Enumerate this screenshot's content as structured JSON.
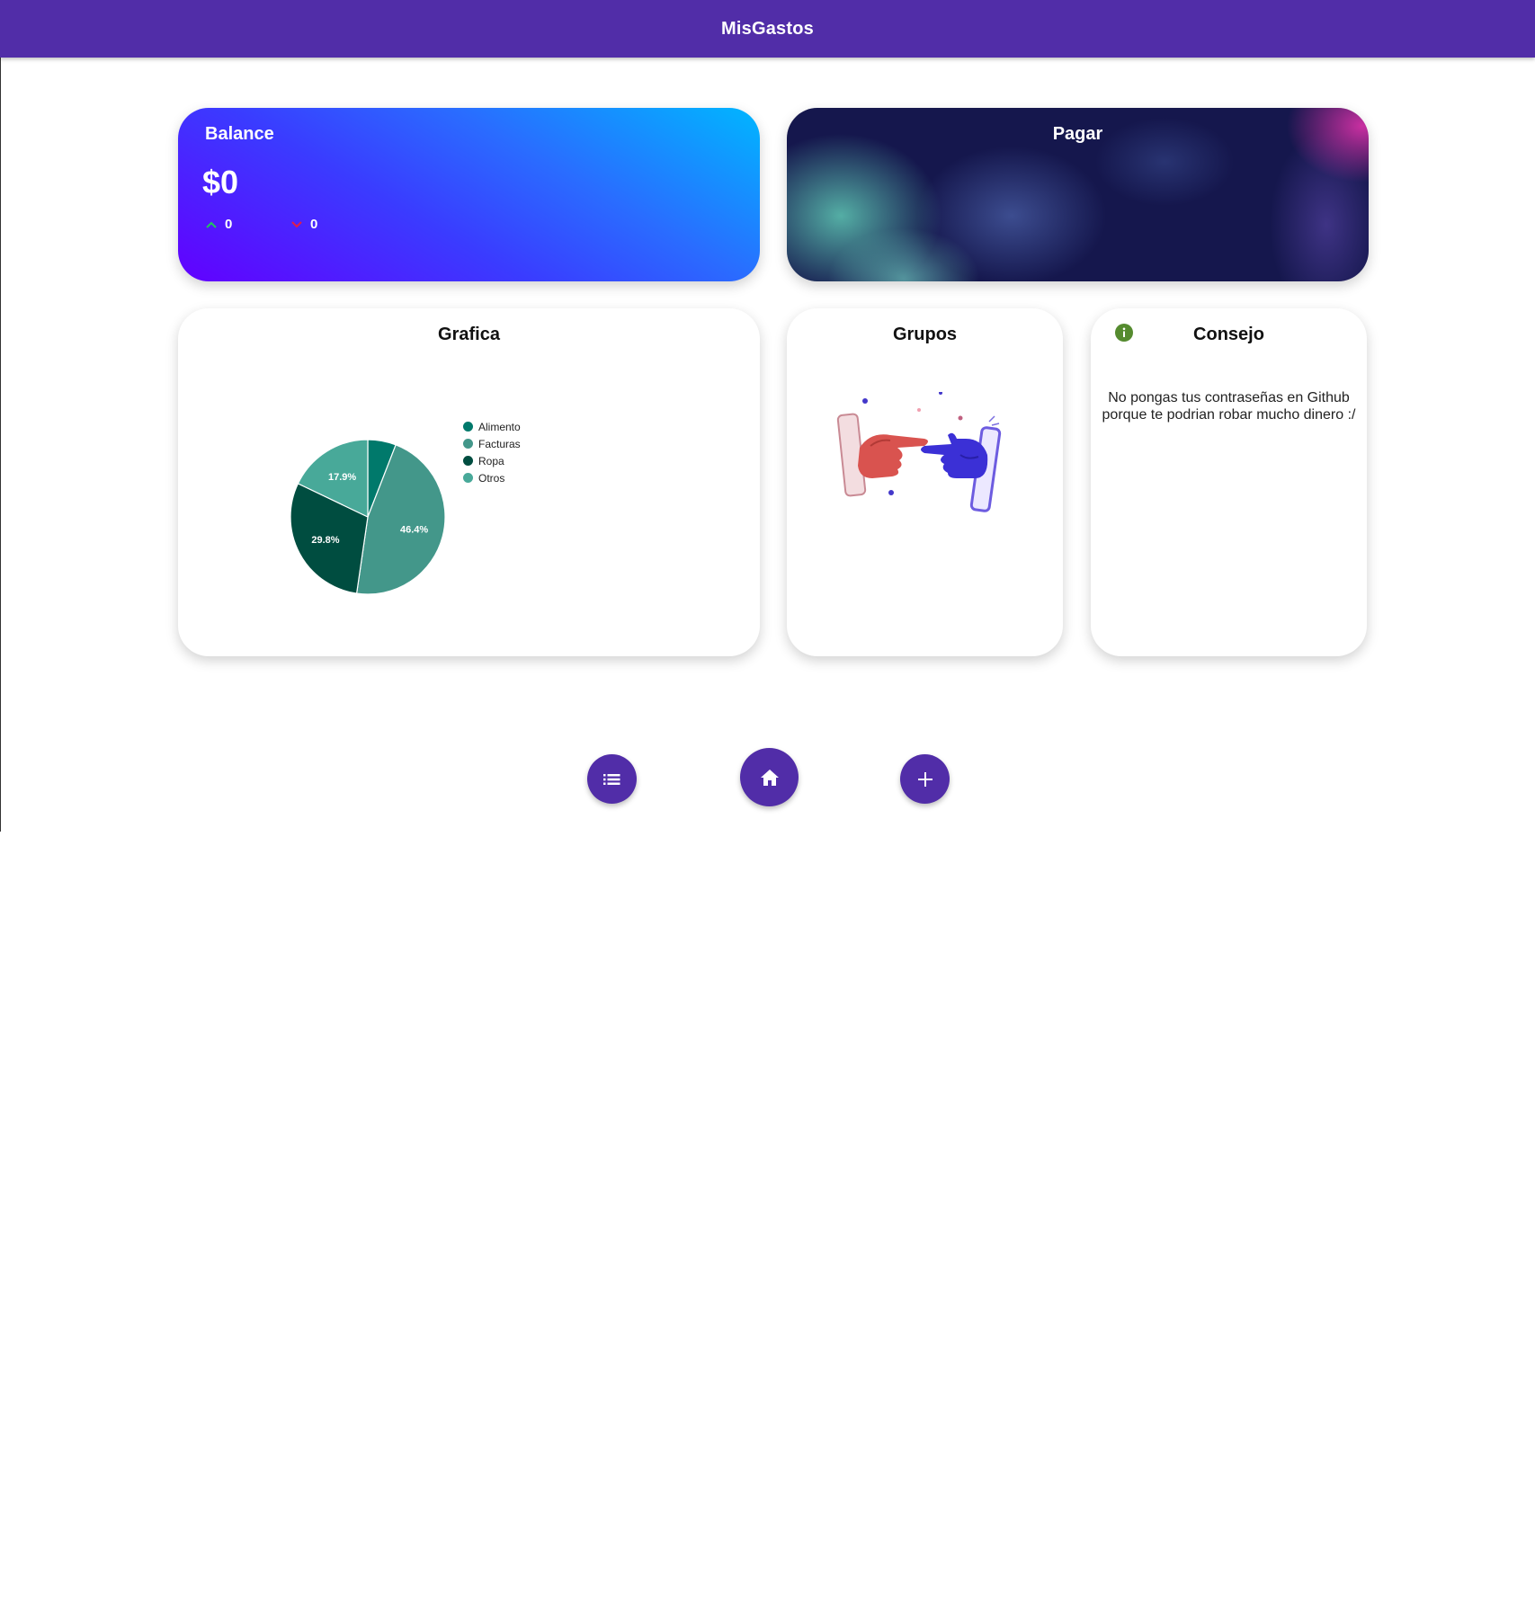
{
  "app": {
    "title": "MisGastos"
  },
  "balance": {
    "title": "Balance",
    "amount": "$0",
    "income_value": "0",
    "expense_value": "0",
    "income_icon": "arrow-up-icon",
    "expense_icon": "arrow-down-icon",
    "income_color": "#22c55e",
    "expense_color": "#e11d48"
  },
  "pagar": {
    "title": "Pagar"
  },
  "grafica": {
    "title": "Grafica"
  },
  "chart_data": {
    "type": "pie",
    "title": "Grafica",
    "categories": [
      "Alimento",
      "Facturas",
      "Ropa",
      "Otros"
    ],
    "values": [
      5.9,
      46.4,
      29.8,
      17.9
    ],
    "labels": [
      "",
      "46.4%",
      "29.8%",
      "17.9%"
    ],
    "colors": [
      "#00796b",
      "#43978a",
      "#004d40",
      "#48a999"
    ],
    "legend": "right"
  },
  "grupos": {
    "title": "Grupos",
    "illustration": "hands-phones-illustration"
  },
  "consejo": {
    "title": "Consejo",
    "icon": "info-icon",
    "icon_color": "#558b2f",
    "text": "No pongas tus contraseñas en Github porque te podrian robar mucho dinero :/"
  },
  "nav": {
    "buttons": [
      {
        "name": "list-button",
        "icon": "list-icon"
      },
      {
        "name": "home-button",
        "icon": "home-icon"
      },
      {
        "name": "add-button",
        "icon": "plus-icon"
      }
    ]
  },
  "colors": {
    "primary": "#512da8"
  }
}
